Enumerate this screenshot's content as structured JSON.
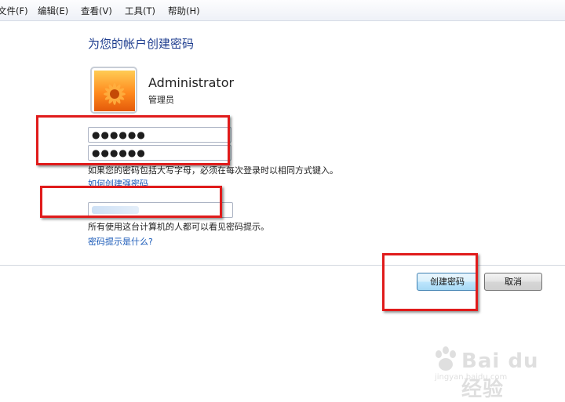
{
  "menu": [
    "文件(F)",
    "编辑(E)",
    "查看(V)",
    "工具(T)",
    "帮助(H)"
  ],
  "page_title": "为您的帐户创建密码",
  "user": {
    "name": "Administrator",
    "type": "管理员"
  },
  "password": {
    "value": "●●●●●●",
    "confirm_value": "●●●●●●"
  },
  "notes": {
    "caps_warning": "如果您的密码包括大写字母，必须在每次登录时以相同方式键入。",
    "hint_visibility": "所有使用这台计算机的人都可以看见密码提示。"
  },
  "links": {
    "strong_password": "如何创建强密码",
    "what_is_hint": "密码提示是什么?"
  },
  "buttons": {
    "create": "创建密码",
    "cancel": "取消"
  },
  "watermark": {
    "brand": "Bai du 经验",
    "url": "jingyan.baidu.com"
  },
  "colors": {
    "title": "#1e3d8f",
    "link": "#1a5ab8",
    "annotation_red": "#e01b1b"
  }
}
